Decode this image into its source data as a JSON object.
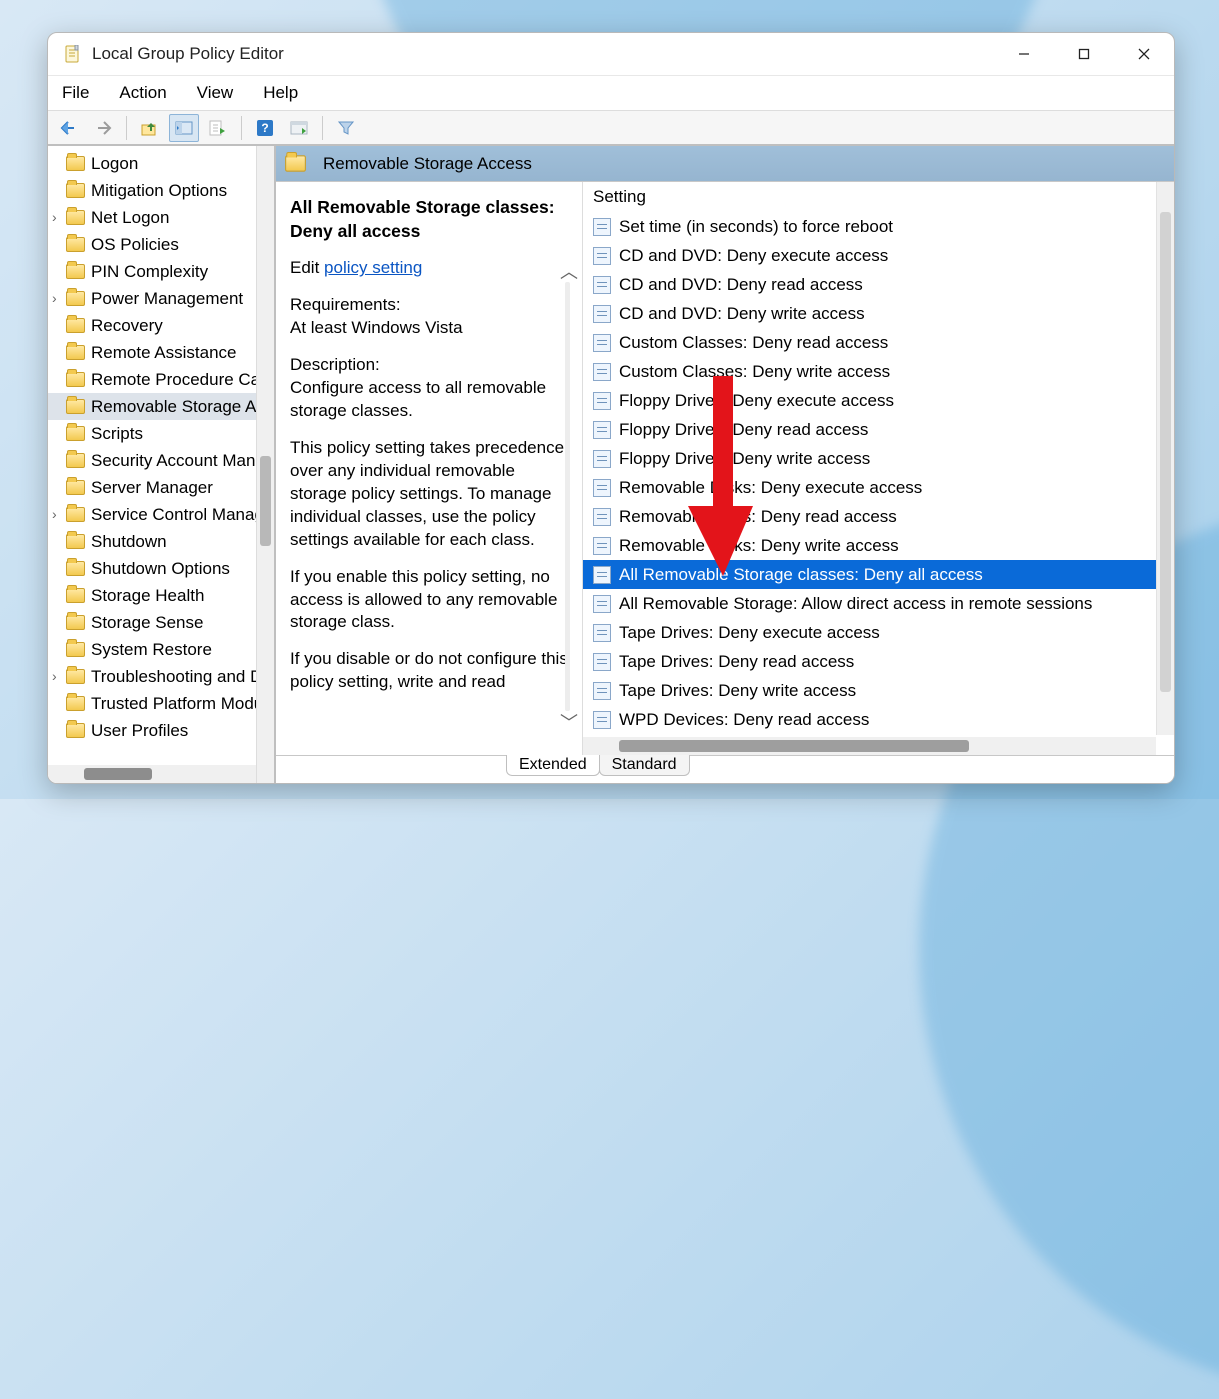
{
  "window": {
    "title": "Local Group Policy Editor"
  },
  "menu": {
    "file": "File",
    "action": "Action",
    "view": "View",
    "help": "Help"
  },
  "tree": {
    "items": [
      {
        "label": "Logon"
      },
      {
        "label": "Mitigation Options"
      },
      {
        "label": "Net Logon",
        "expandable": true
      },
      {
        "label": "OS Policies"
      },
      {
        "label": "PIN Complexity"
      },
      {
        "label": "Power Management",
        "expandable": true
      },
      {
        "label": "Recovery"
      },
      {
        "label": "Remote Assistance"
      },
      {
        "label": "Remote Procedure Call"
      },
      {
        "label": "Removable Storage Access",
        "selected": true
      },
      {
        "label": "Scripts"
      },
      {
        "label": "Security Account Manager"
      },
      {
        "label": "Server Manager"
      },
      {
        "label": "Service Control Manager",
        "expandable": true
      },
      {
        "label": "Shutdown"
      },
      {
        "label": "Shutdown Options"
      },
      {
        "label": "Storage Health"
      },
      {
        "label": "Storage Sense"
      },
      {
        "label": "System Restore"
      },
      {
        "label": "Troubleshooting and Diagnostics",
        "expandable": true
      },
      {
        "label": "Trusted Platform Module"
      },
      {
        "label": "User Profiles"
      }
    ]
  },
  "pane": {
    "header": "Removable Storage Access",
    "selected_title": "All Removable Storage classes: Deny all access",
    "edit_prefix": "Edit",
    "edit_link": "policy setting",
    "requirements_label": "Requirements:",
    "requirements_value": "At least Windows Vista",
    "description_label": "Description:",
    "description_p1": "Configure access to all removable storage classes.",
    "description_p2": "This policy setting takes precedence over any individual removable storage policy settings. To manage individual classes, use the policy settings available for each class.",
    "description_p3": "If you enable this policy setting, no access is allowed to any removable storage class.",
    "description_p4": "If you disable or do not configure this policy setting, write and read"
  },
  "settings": {
    "column": "Setting",
    "items": [
      "Set time (in seconds) to force reboot",
      "CD and DVD: Deny execute access",
      "CD and DVD: Deny read access",
      "CD and DVD: Deny write access",
      "Custom Classes: Deny read access",
      "Custom Classes: Deny write access",
      "Floppy Drives: Deny execute access",
      "Floppy Drives: Deny read access",
      "Floppy Drives: Deny write access",
      "Removable Disks: Deny execute access",
      "Removable Disks: Deny read access",
      "Removable Disks: Deny write access",
      "All Removable Storage classes: Deny all access",
      "All Removable Storage: Allow direct access in remote sessions",
      "Tape Drives: Deny execute access",
      "Tape Drives: Deny read access",
      "Tape Drives: Deny write access",
      "WPD Devices: Deny read access"
    ],
    "selected_index": 12
  },
  "tabs": {
    "extended": "Extended",
    "standard": "Standard"
  }
}
